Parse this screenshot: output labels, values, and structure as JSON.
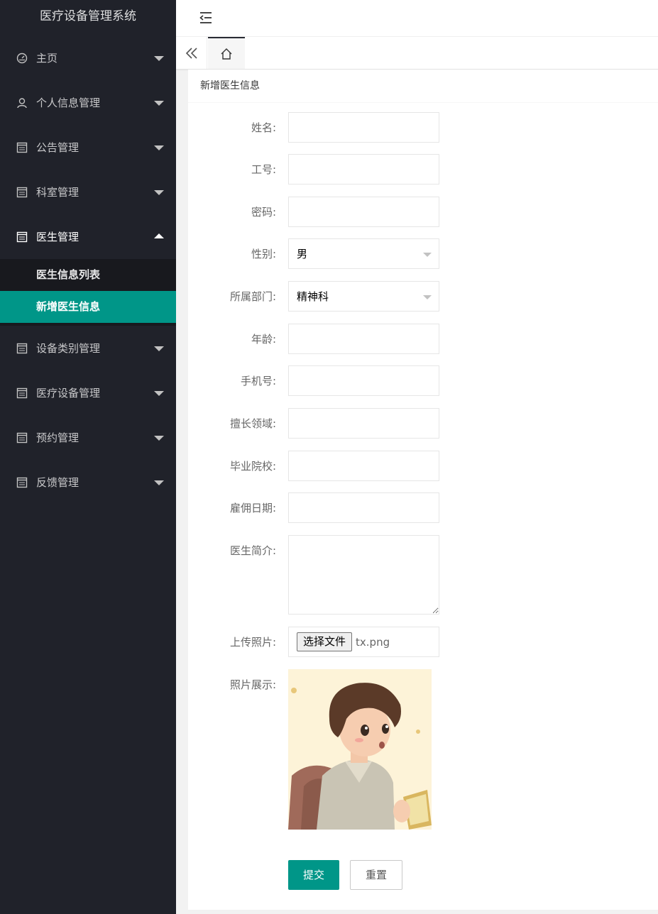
{
  "app": {
    "title": "医疗设备管理系统"
  },
  "sidebar": {
    "items": [
      {
        "label": "主页",
        "icon": "dashboard-icon"
      },
      {
        "label": "个人信息管理",
        "icon": "user-icon"
      },
      {
        "label": "公告管理",
        "icon": "list-icon"
      },
      {
        "label": "科室管理",
        "icon": "list-icon"
      },
      {
        "label": "医生管理",
        "icon": "list-icon",
        "open": true,
        "children": [
          {
            "label": "医生信息列表"
          },
          {
            "label": "新增医生信息",
            "active": true
          }
        ]
      },
      {
        "label": "设备类别管理",
        "icon": "list-icon"
      },
      {
        "label": "医疗设备管理",
        "icon": "list-icon"
      },
      {
        "label": "预约管理",
        "icon": "list-icon"
      },
      {
        "label": "反馈管理",
        "icon": "list-icon"
      }
    ]
  },
  "card": {
    "title": "新增医生信息"
  },
  "form": {
    "name_label": "姓名:",
    "id_label": "工号:",
    "password_label": "密码:",
    "gender_label": "性别:",
    "gender_value": "男",
    "dept_label": "所属部门:",
    "dept_value": "精神科",
    "age_label": "年龄:",
    "phone_label": "手机号:",
    "specialty_label": "擅长领域:",
    "school_label": "毕业院校:",
    "hire_label": "雇佣日期:",
    "intro_label": "医生简介:",
    "upload_label": "上传照片:",
    "file_button": "选择文件",
    "file_name": "tx.png",
    "preview_label": "照片展示:",
    "submit": "提交",
    "reset": "重置"
  },
  "colors": {
    "sidebar_bg": "#20222a",
    "accent": "#009688",
    "submenu_bg": "#18191e"
  }
}
